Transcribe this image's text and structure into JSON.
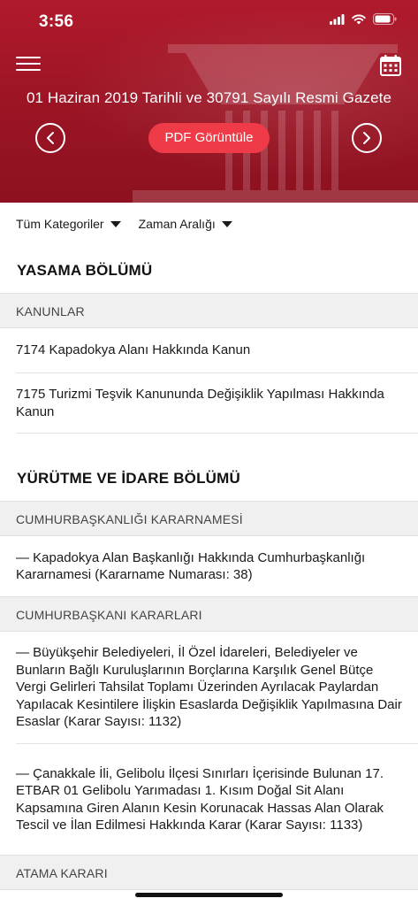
{
  "status_bar": {
    "time": "3:56"
  },
  "header": {
    "title": "01 Haziran 2019 Tarihli ve 30791 Sayılı Resmi Gazete",
    "pdf_button": "PDF Görüntüle",
    "accent_color": "#ef3b47",
    "background_color": "#9a1424"
  },
  "filters": {
    "category": "Tüm Kategoriler",
    "time_range": "Zaman Aralığı"
  },
  "sections": [
    {
      "title": "YASAMA BÖLÜMÜ",
      "categories": [
        {
          "name": "KANUNLAR",
          "items": [
            "7174 Kapadokya Alanı Hakkında Kanun",
            "7175 Turizmi Teşvik Kanununda Değişiklik Yapılması Hakkında Kanun"
          ]
        }
      ]
    },
    {
      "title": "YÜRÜTME VE İDARE BÖLÜMÜ",
      "categories": [
        {
          "name": "CUMHURBAŞKANLIĞI KARARNAMESİ",
          "items": [
            "— Kapadokya Alan Başkanlığı Hakkında Cumhurbaşkanlığı Kararnamesi (Kararname Numarası: 38)"
          ]
        },
        {
          "name": "CUMHURBAŞKANI KARARLARI",
          "items": [
            "— Büyükşehir Belediyeleri, İl Özel İdareleri, Belediyeler ve Bunların Bağlı Kuruluşlarının Borçlarına Karşılık Genel Bütçe Vergi Gelirleri Tahsilat Toplamı Üzerinden Ayrılacak Paylardan Yapılacak Kesintilere İlişkin Esaslarda Değişiklik Yapılmasına Dair Esaslar (Karar Sayısı: 1132)",
            "— Çanakkale İli, Gelibolu İlçesi Sınırları İçerisinde Bulunan 17. ETBAR 01 Gelibolu Yarımadası 1. Kısım Doğal Sit Alanı Kapsamına Giren Alanın Kesin Korunacak Hassas Alan Olarak Tescil ve İlan Edilmesi Hakkında Karar (Karar Sayısı: 1133)"
          ]
        },
        {
          "name": "ATAMA KARARI",
          "items": []
        }
      ]
    }
  ],
  "icons": {
    "menu": "hamburger-menu-icon",
    "calendar": "calendar-icon",
    "prev": "chevron-left-icon",
    "next": "chevron-right-icon",
    "dropdown": "caret-down-icon"
  }
}
